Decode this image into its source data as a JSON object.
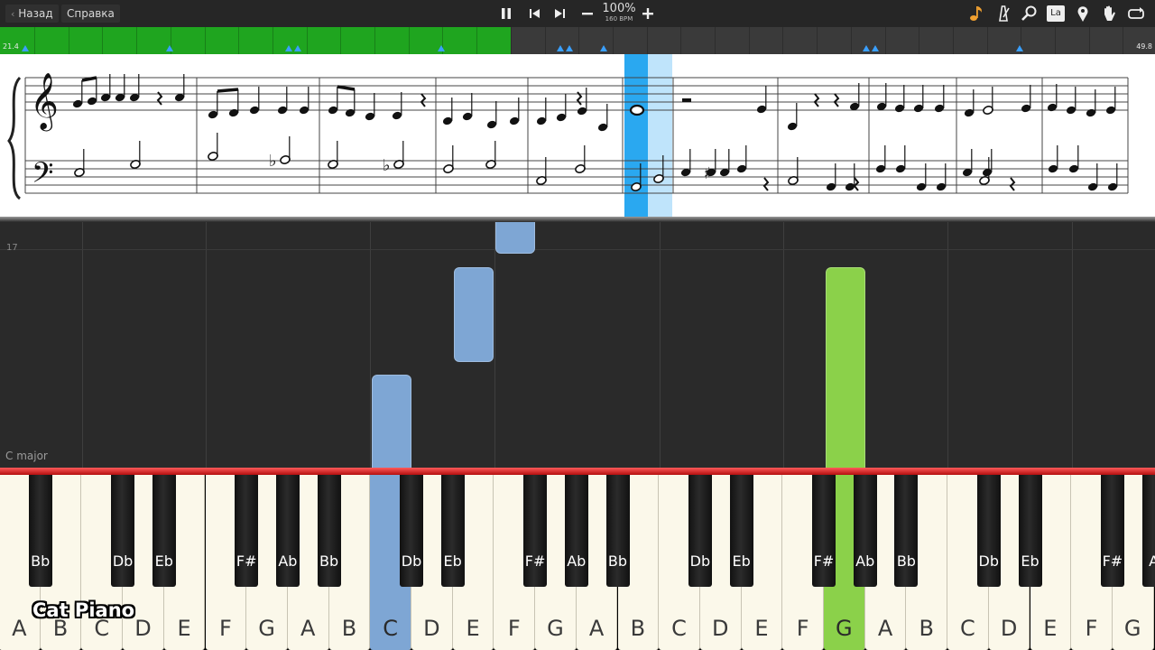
{
  "toolbar": {
    "back_label": "Назад",
    "help_label": "Справка",
    "zoom": "100%",
    "bpm": "160 BPM",
    "icons": [
      "pause-icon",
      "skip-back-icon",
      "skip-forward-icon",
      "minus-icon",
      "plus-icon",
      "note-icon",
      "metronome-icon",
      "search-icon",
      "note-label-icon",
      "pin-icon",
      "hand-icon",
      "loop-icon"
    ],
    "note_label_text": "La"
  },
  "timeline": {
    "start_label": "21.4",
    "end_label": "49.8",
    "played_fraction": 0.442,
    "played_color": "#1fa51f",
    "marker_color": "#3aa0ff"
  },
  "roll": {
    "measure_number": "17",
    "key_signature": "C major"
  },
  "colors": {
    "left_hand": "#7ea6d4",
    "right_hand": "#8bd14a",
    "highlight": "#2aa8f0"
  },
  "keyboard": {
    "white_keys": [
      "A",
      "B",
      "C",
      "D",
      "E",
      "F",
      "G",
      "A",
      "B",
      "C",
      "D",
      "E",
      "F",
      "G",
      "A",
      "B",
      "C",
      "D",
      "E",
      "F",
      "G",
      "A",
      "B",
      "C",
      "D",
      "E",
      "F",
      "G"
    ],
    "black_keys": [
      "Bb",
      "Db",
      "Eb",
      "F#",
      "Ab",
      "Bb",
      "Db",
      "Eb",
      "F#",
      "Ab",
      "Bb",
      "Db",
      "Eb",
      "F#",
      "Ab",
      "Bb",
      "Db",
      "Eb",
      "F#",
      "A"
    ],
    "active_blue": "C",
    "active_green": "G"
  },
  "watermark": "Cat Piano"
}
